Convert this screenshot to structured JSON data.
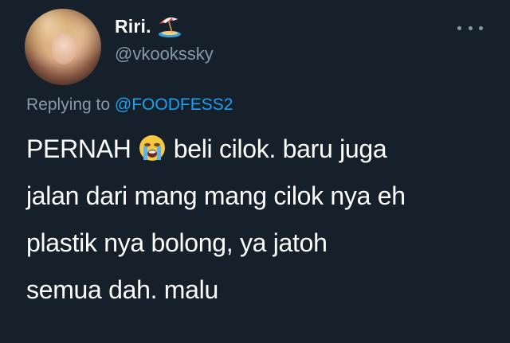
{
  "user": {
    "display_name": "Riri.",
    "name_emoji": "beach-umbrella-icon",
    "handle": "@vkookssky"
  },
  "reply": {
    "prefix": "Replying to ",
    "mention": "@FOODFESS2"
  },
  "tweet": {
    "line1_before_emoji": "PERNAH ",
    "emoji": "loudly-crying-face-icon",
    "line1_after_emoji": " beli cilok. baru juga",
    "line2": "jalan dari mang mang cilok nya eh",
    "line3": "plastik nya bolong, ya jatoh",
    "line4": "semua dah. malu"
  },
  "colors": {
    "background": "#15202b",
    "text": "#ffffff",
    "muted": "#8899a6",
    "link": "#1da1f2"
  }
}
